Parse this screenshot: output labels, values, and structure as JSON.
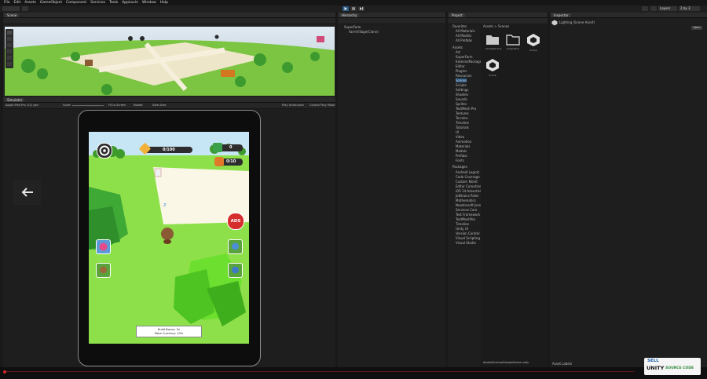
{
  "menu": [
    "File",
    "Edit",
    "Assets",
    "GameObject",
    "Component",
    "Services",
    "Tools",
    "AppLovin",
    "Window",
    "Help"
  ],
  "toolbar": {
    "layers_label": "Layers",
    "layout_label": "2 by 3"
  },
  "scene_panel": {
    "tab_label": "Scene"
  },
  "simulator_panel": {
    "tab_label": "Simulator",
    "device_label": "Apple iPad Pro (12) gen",
    "scale_label": "Scale",
    "fit_label": "Fit to Screen",
    "rotate_label": "Rotate",
    "safe_area_label": "Safe Area",
    "play_mode_label": "Play Unfocused",
    "control_label": "Control Play Mode"
  },
  "game_ui": {
    "progress_text": "0/100",
    "coins_text": "0",
    "coins_capacity_text": "0/10",
    "ads_label": "ADS",
    "info_line1": "Build Bonus: 2x",
    "info_line2": "More Currency: 10%"
  },
  "hierarchy_panel": {
    "tab_label": "Hierarchy",
    "scene_name": "SuperFarm",
    "item_label": "FarmVillage(Clone)"
  },
  "project_panel": {
    "tab_label": "Project",
    "favorites_label": "Favorites",
    "favorites_items": [
      "All Materials",
      "All Models",
      "All Prefabs"
    ],
    "assets_label": "Assets",
    "asset_items": [
      "Art",
      "SuperFarm",
      "ExternalPackages",
      "Editor",
      "Plugins",
      "Resources",
      "Scenes",
      "Scripts",
      "Settings",
      "Shaders",
      "Sounds",
      "Sprites",
      "TextMesh Pro",
      "Textures",
      "Terrains",
      "Timeline",
      "Tutorials",
      "UI",
      "Video",
      "Animation",
      "Materials",
      "Models",
      "Prefabs",
      "Fonts"
    ],
    "selected_item": "Scenes",
    "packages_label": "Packages",
    "package_items": [
      "Android Logcat",
      "Code Coverage",
      "Custom NUnit",
      "Editor Coroutines",
      "iOS 14 Advertising",
      "JetBrains Rider",
      "Mathematics",
      "Newtonsoft Json",
      "Services Core",
      "Test Framework",
      "TextMeshPro",
      "Timeline",
      "Unity UI",
      "Version Control",
      "Visual Scripting",
      "Visual Studio"
    ],
    "breadcrumb": "Assets > Scenes",
    "grid_items": [
      "SampleScene",
      "SuperFarm",
      "Scene",
      "Scene"
    ],
    "footer_path": "Assets/Scenes/SampleScene.unity"
  },
  "inspector_panel": {
    "tab_label": "Inspector",
    "object_label": "Lighting (Scene Asset)",
    "open_label": "Open"
  },
  "asset_labels_label": "Asset Labels",
  "watermark": {
    "line1": "SELL",
    "line2": "UNITY",
    "line3": "SOURCE CODE"
  }
}
